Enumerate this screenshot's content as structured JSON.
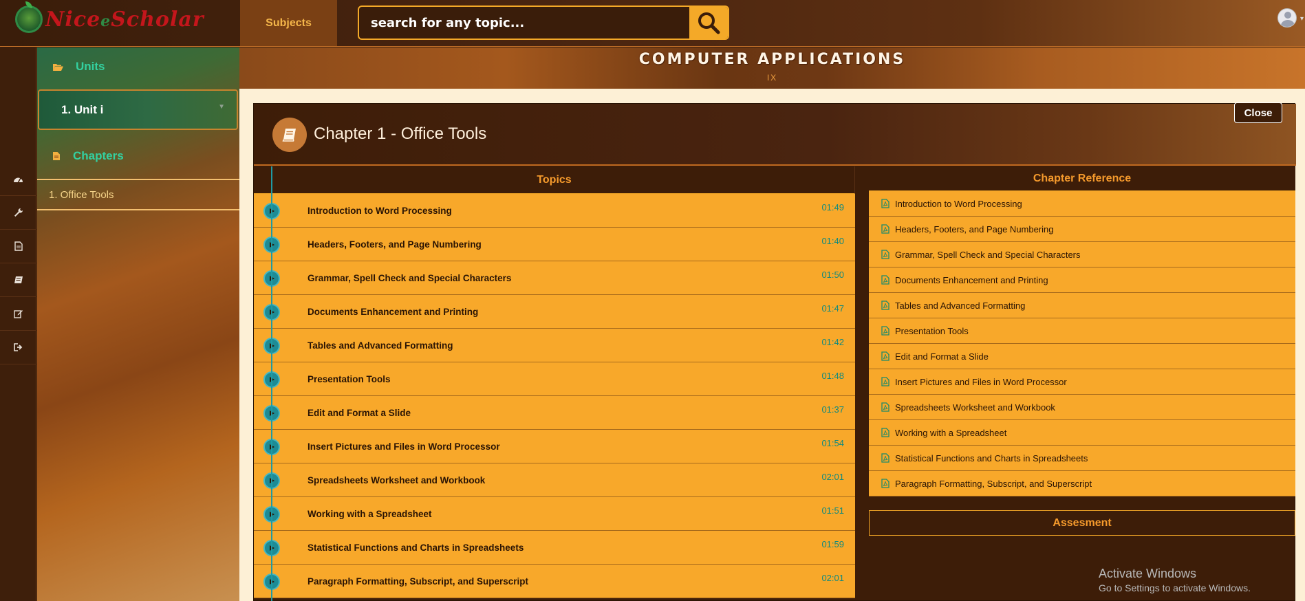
{
  "brand": {
    "name_part1": "Nice",
    "name_part2": "e",
    "name_part3": "Scholar"
  },
  "topbar": {
    "subjects_label": "Subjects",
    "search_placeholder": "search for any topic..."
  },
  "rail": {
    "items": [
      {
        "icon": "dashboard-icon"
      },
      {
        "icon": "wrench-icon"
      },
      {
        "icon": "document-icon"
      },
      {
        "icon": "book-icon"
      },
      {
        "icon": "edit-icon"
      },
      {
        "icon": "sign-out-icon"
      }
    ]
  },
  "sidebar": {
    "units_label": "Units",
    "unit_item": "1. Unit i",
    "chapters_label": "Chapters",
    "chapter_item": "1. Office Tools"
  },
  "banner": {
    "title": "COMPUTER APPLICATIONS",
    "subtitle": "IX"
  },
  "chapter": {
    "title": "Chapter 1 - Office Tools",
    "close_label": "Close",
    "topics_label": "Topics",
    "topics": [
      {
        "name": "Introduction to Word Processing",
        "time": "01:49"
      },
      {
        "name": "Headers, Footers, and Page Numbering",
        "time": "01:40"
      },
      {
        "name": "Grammar, Spell Check and Special Characters",
        "time": "01:50"
      },
      {
        "name": "Documents Enhancement and Printing",
        "time": "01:47"
      },
      {
        "name": "Tables and Advanced Formatting",
        "time": "01:42"
      },
      {
        "name": "Presentation Tools",
        "time": "01:48"
      },
      {
        "name": "Edit and Format a Slide",
        "time": "01:37"
      },
      {
        "name": "Insert Pictures and Files in Word Processor",
        "time": "01:54"
      },
      {
        "name": "Spreadsheets Worksheet and Workbook",
        "time": "02:01"
      },
      {
        "name": "Working with a Spreadsheet",
        "time": "01:51"
      },
      {
        "name": "Statistical Functions and Charts in Spreadsheets",
        "time": "01:59"
      },
      {
        "name": "Paragraph Formatting, Subscript, and Superscript",
        "time": "02:01"
      }
    ],
    "reference_label": "Chapter Reference",
    "references": [
      "Introduction to Word Processing",
      "Headers, Footers, and Page Numbering",
      "Grammar, Spell Check and Special Characters",
      "Documents Enhancement and Printing",
      "Tables and Advanced Formatting",
      "Presentation Tools",
      "Edit and Format a Slide",
      "Insert Pictures and Files in Word Processor",
      "Spreadsheets Worksheet and Workbook",
      "Working with a Spreadsheet",
      "Statistical Functions and Charts in Spreadsheets",
      "Paragraph Formatting, Subscript, and Superscript"
    ],
    "assessment_label": "Assesment"
  },
  "watermark": {
    "title": "Activate Windows",
    "subtitle": "Go to Settings to activate Windows."
  },
  "colors": {
    "accent_orange": "#f8a82a",
    "dark_brown": "#3d1d08",
    "teal": "#1d8b95",
    "header_orange": "#f59a2c"
  }
}
